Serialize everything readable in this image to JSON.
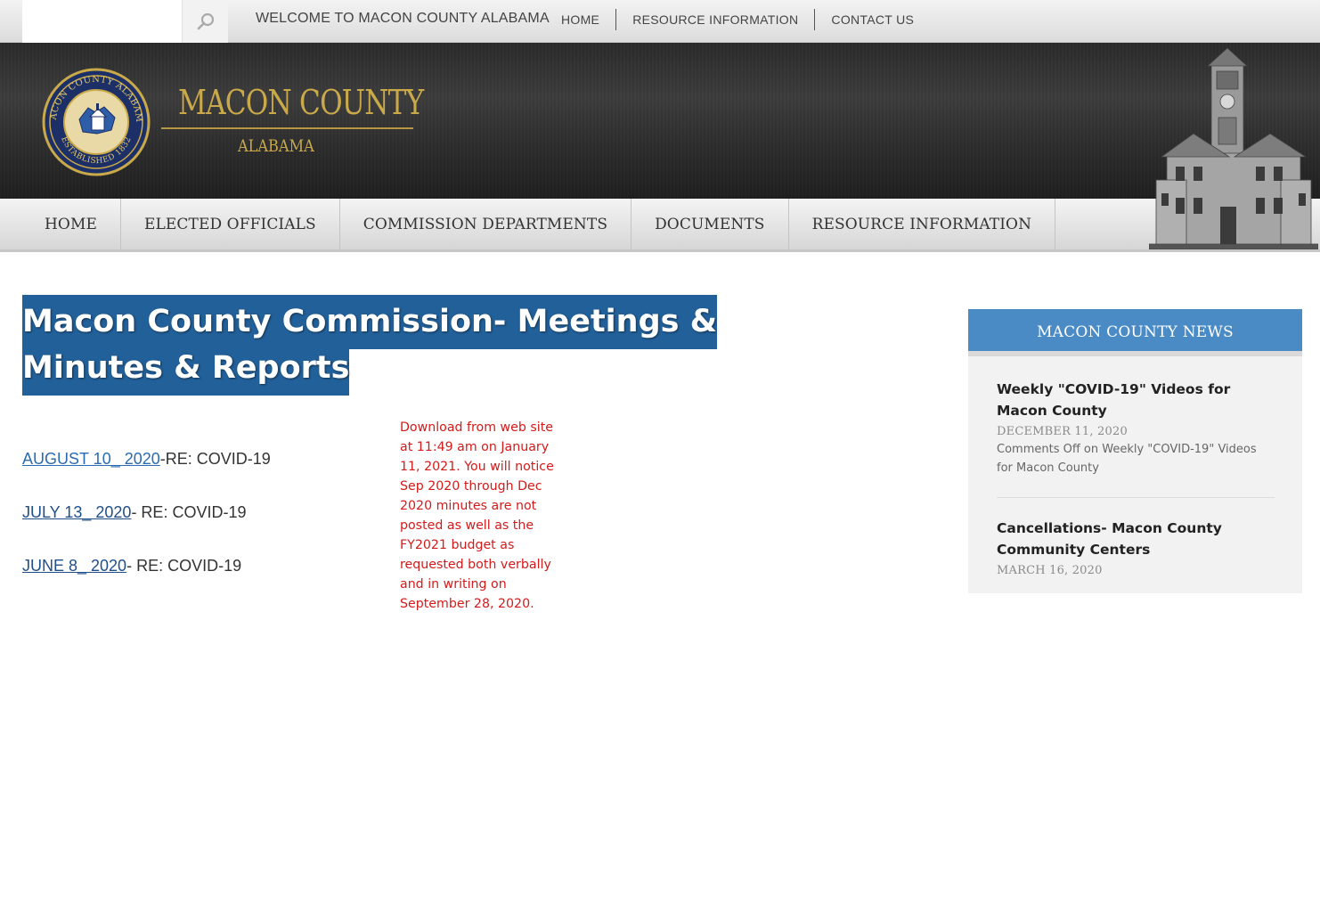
{
  "topbar": {
    "search_placeholder": "",
    "welcome": "WELCOME TO MACON COUNTY ALABAMA",
    "links": [
      "HOME",
      "RESOURCE INFORMATION",
      "CONTACT US"
    ]
  },
  "header": {
    "title": "MACON COUNTY",
    "subtitle": "ALABAMA",
    "seal_text": "MACON COUNTY ALABAMA · ESTABLISHED 1832"
  },
  "mainnav": [
    "HOME",
    "ELECTED OFFICIALS",
    "COMMISSION DEPARTMENTS",
    "DOCUMENTS",
    "RESOURCE INFORMATION"
  ],
  "page": {
    "title": " Macon County Commission- Meetings & Minutes & Reports ",
    "minutes": [
      {
        "link": "AUGUST 10_ 2020",
        "suffix": "-RE: COVID-19"
      },
      {
        "link": "JULY 13_ 2020",
        "suffix": "- RE: COVID-19"
      },
      {
        "link": "JUNE 8_ 2020",
        "suffix": "- RE: COVID-19"
      }
    ],
    "notice": "Download from web site at 11:49 am on January 11, 2021.  You will notice Sep 2020 through Dec 2020 minutes are not posted as well as the FY2021 budget as requested both verbally and in writing on September 28, 2020."
  },
  "news": {
    "heading": "MACON COUNTY NEWS",
    "items": [
      {
        "title": "Weekly \"COVID-19\" Videos for Macon County",
        "date": "DECEMBER 11, 2020",
        "comments": "Comments Off on Weekly \"COVID-19\" Videos for Macon County"
      },
      {
        "title": "Cancellations- Macon County Community Centers",
        "date": "MARCH 16, 2020",
        "comments": ""
      }
    ]
  },
  "colors": {
    "title_bg": "#22609a",
    "news_head": "#4a8ac5",
    "brand_gold": "#c9a94a",
    "notice_red": "#d41a1a"
  }
}
